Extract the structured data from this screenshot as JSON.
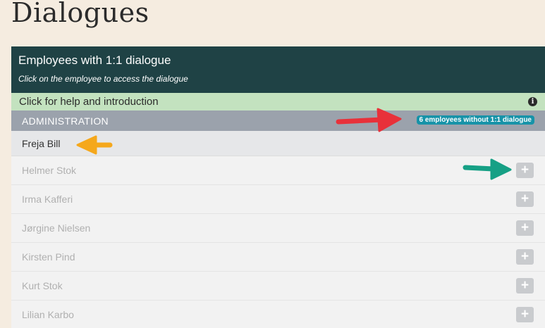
{
  "page": {
    "title": "Dialogues"
  },
  "panel": {
    "title": "Employees with 1:1 dialogue",
    "subtitle": "Click on the employee to access the dialogue",
    "help_label": "Click for help and introduction",
    "help_icon": "info-icon"
  },
  "group": {
    "name": "ADMINISTRATION",
    "badge": "6 employees without 1:1 dialogue"
  },
  "employees": [
    {
      "name": "Freja Bill",
      "has_dialogue": true
    },
    {
      "name": "Helmer Stok",
      "has_dialogue": false
    },
    {
      "name": "Irma Kafferi",
      "has_dialogue": false
    },
    {
      "name": "Jørgine Nielsen",
      "has_dialogue": false
    },
    {
      "name": "Kirsten Pind",
      "has_dialogue": false
    },
    {
      "name": "Kurt Stok",
      "has_dialogue": false
    },
    {
      "name": "Lilian Karbo",
      "has_dialogue": false
    }
  ],
  "plus_symbol": "+",
  "colors": {
    "header_bg": "#1f4245",
    "help_bg": "#c3e2bf",
    "group_bg": "#9ba2ac",
    "badge_bg": "#1793a8",
    "arrow_red": "#e8313a",
    "arrow_orange": "#f5a81c",
    "arrow_green": "#16a085"
  }
}
